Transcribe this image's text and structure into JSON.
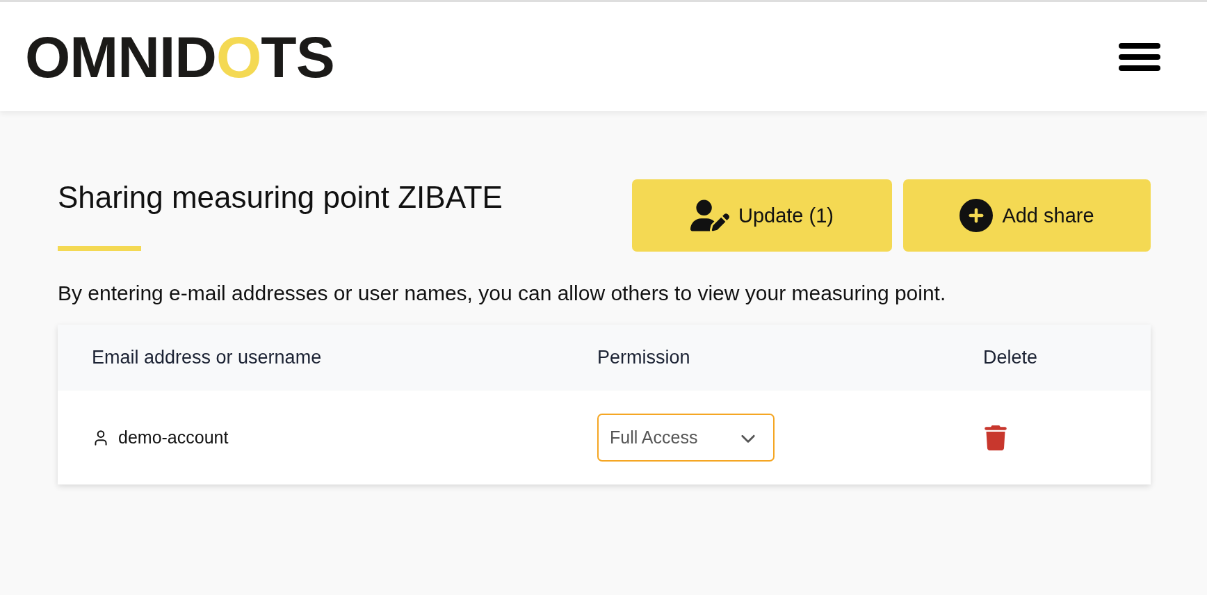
{
  "header": {
    "logo": {
      "segments": [
        {
          "text": "OMNID",
          "highlighted": false
        },
        {
          "text": "O",
          "highlighted": true
        },
        {
          "text": "TS",
          "highlighted": false
        }
      ]
    }
  },
  "page": {
    "title": "Sharing measuring point ZIBATE",
    "buttons": [
      {
        "kind": "update",
        "label": "Update (1)"
      },
      {
        "kind": "add",
        "label": "Add share"
      }
    ],
    "description": "By entering e-mail addresses or user names, you can allow others to view your measuring point."
  },
  "table": {
    "columns": [
      "Email address or username",
      "Permission",
      "Delete"
    ],
    "rows": [
      {
        "user": "demo-account",
        "permission": "Full Access"
      }
    ]
  }
}
